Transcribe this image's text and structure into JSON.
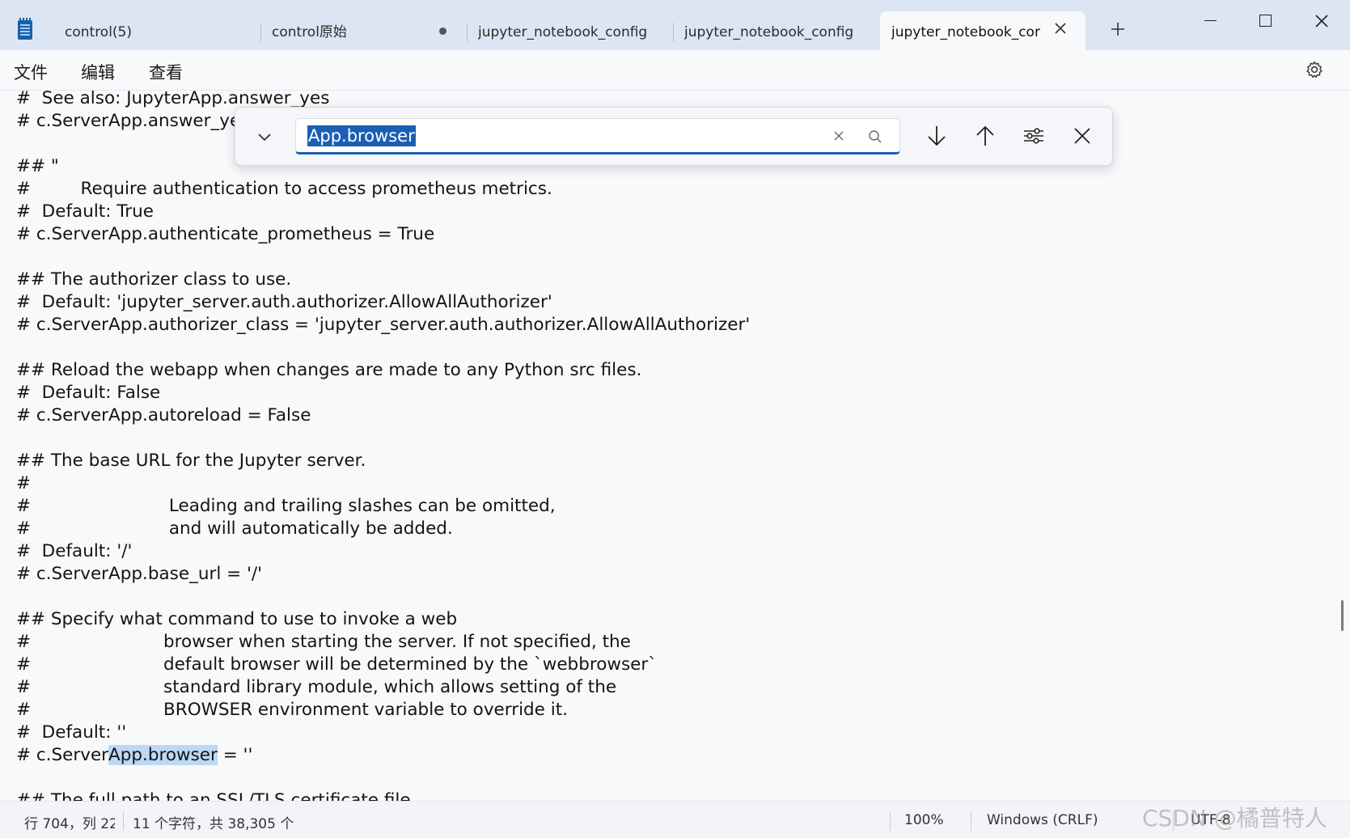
{
  "tabs": [
    {
      "label": "control(5)"
    },
    {
      "label": "control原始"
    },
    {
      "label": "jupyter_notebook_config"
    },
    {
      "label": "jupyter_notebook_config"
    },
    {
      "label": "jupyter_notebook_cor"
    }
  ],
  "window_controls": {
    "minimize": "minimize-icon",
    "maximize": "maximize-icon",
    "close": "close-icon"
  },
  "menu": {
    "file": "文件",
    "edit": "编辑",
    "view": "查看"
  },
  "find": {
    "query": "App.browser",
    "icons": [
      "chevron-down-icon",
      "clear-icon",
      "search-icon",
      "arrow-down-icon",
      "arrow-up-icon",
      "options-icon",
      "close-icon"
    ]
  },
  "editor": {
    "lines": [
      "#  See also: JupyterApp.answer_yes",
      "# c.ServerApp.answer_yes = False",
      "",
      "## \"",
      "#         Require authentication to access prometheus metrics.",
      "#  Default: True",
      "# c.ServerApp.authenticate_prometheus = True",
      "",
      "## The authorizer class to use.",
      "#  Default: 'jupyter_server.auth.authorizer.AllowAllAuthorizer'",
      "# c.ServerApp.authorizer_class = 'jupyter_server.auth.authorizer.AllowAllAuthorizer'",
      "",
      "## Reload the webapp when changes are made to any Python src files.",
      "#  Default: False",
      "# c.ServerApp.autoreload = False",
      "",
      "## The base URL for the Jupyter server.",
      "#",
      "#                         Leading and trailing slashes can be omitted,",
      "#                         and will automatically be added.",
      "#  Default: '/'",
      "# c.ServerApp.base_url = '/'",
      "",
      "## Specify what command to use to invoke a web",
      "#                        browser when starting the server. If not specified, the",
      "#                        default browser will be determined by the `webbrowser`",
      "#                        standard library module, which allows setting of the",
      "#                        BROWSER environment variable to override it.",
      "#  Default: ''",
      "# c.ServerApp.browser = ''",
      "",
      "## The full path to an SSL/TLS certificate file."
    ],
    "highlight_line_index": 29,
    "highlight_prefix": "# c.Server",
    "highlight_text": "App.browser",
    "highlight_suffix": " = ''"
  },
  "status": {
    "position": "行 704，列 22",
    "selection": "11 个字符，共 38,305 个",
    "zoom": "100%",
    "line_ending": "Windows (CRLF)",
    "encoding": "UTF-8"
  },
  "watermark": "CSDN @橘普特人",
  "colors": {
    "accent": "#1a5fb4",
    "highlight": "#bcd8f5",
    "titlebar": "#dbe6f2"
  }
}
